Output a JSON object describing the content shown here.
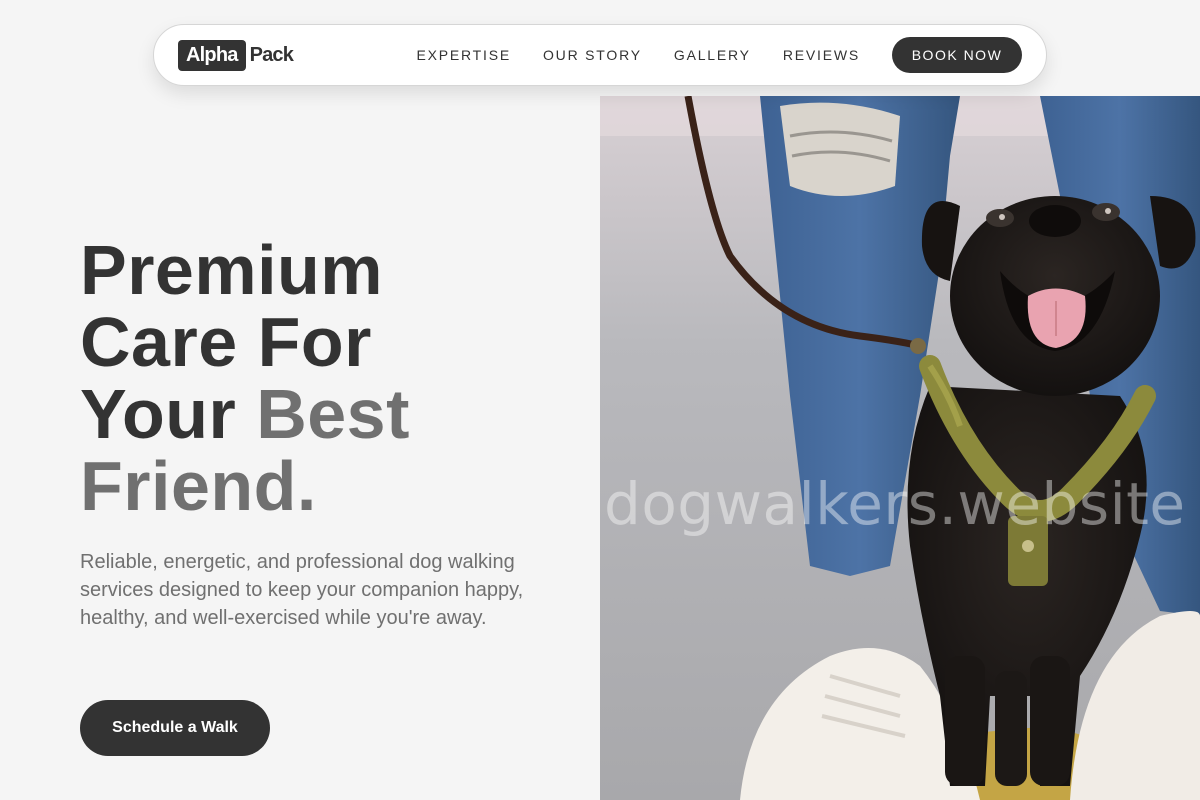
{
  "brand": {
    "logo_box_text": "Alpha",
    "logo_rest_text": "Pack"
  },
  "nav": {
    "links": [
      "EXPERTISE",
      "OUR STORY",
      "GALLERY",
      "REVIEWS"
    ],
    "cta_label": "BOOK NOW"
  },
  "hero": {
    "title_line1": "Premium",
    "title_line2": "Care For",
    "title_line3_a": "Your ",
    "title_line3_b": "Best",
    "title_line4": "Friend.",
    "description": "Reliable, energetic, and professional dog walking services designed to keep your companion happy, healthy, and well-exercised while you're away.",
    "cta_label": "Schedule a Walk"
  },
  "image": {
    "watermark": "dogwalkers.website",
    "subject": "black-pug-on-leash-photo"
  },
  "colors": {
    "background": "#f5f5f5",
    "primary_dark": "#333333",
    "accent_gray": "#707070",
    "white": "#ffffff"
  }
}
